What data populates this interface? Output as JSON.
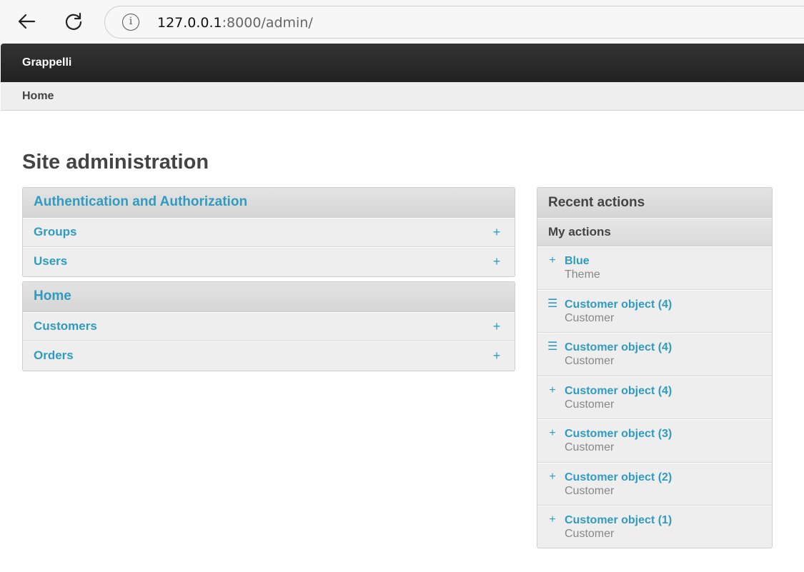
{
  "browser": {
    "url_host": "127.0.0.1",
    "url_path": ":8000/admin/"
  },
  "header": {
    "brand": "Grappelli"
  },
  "breadcrumbs": {
    "home": "Home"
  },
  "page": {
    "title": "Site administration"
  },
  "modules": [
    {
      "title": "Authentication and Authorization",
      "rows": [
        {
          "label": "Groups",
          "add": "+"
        },
        {
          "label": "Users",
          "add": "+"
        }
      ]
    },
    {
      "title": "Home",
      "rows": [
        {
          "label": "Customers",
          "add": "+"
        },
        {
          "label": "Orders",
          "add": "+"
        }
      ]
    }
  ],
  "recent": {
    "title": "Recent actions",
    "subtitle": "My actions",
    "items": [
      {
        "icon": "add-icon",
        "glyph": "+",
        "title": "Blue",
        "type": "Theme"
      },
      {
        "icon": "change-icon",
        "glyph": "☰",
        "title": "Customer object (4)",
        "type": "Customer"
      },
      {
        "icon": "change-icon",
        "glyph": "☰",
        "title": "Customer object (4)",
        "type": "Customer"
      },
      {
        "icon": "add-icon",
        "glyph": "+",
        "title": "Customer object (4)",
        "type": "Customer"
      },
      {
        "icon": "add-icon",
        "glyph": "+",
        "title": "Customer object (3)",
        "type": "Customer"
      },
      {
        "icon": "add-icon",
        "glyph": "+",
        "title": "Customer object (2)",
        "type": "Customer"
      },
      {
        "icon": "add-icon",
        "glyph": "+",
        "title": "Customer object (1)",
        "type": "Customer"
      }
    ]
  },
  "colors": {
    "link": "#309bbf",
    "header_bg": "#2a2a2a",
    "panel_bg": "#eeeeee"
  }
}
